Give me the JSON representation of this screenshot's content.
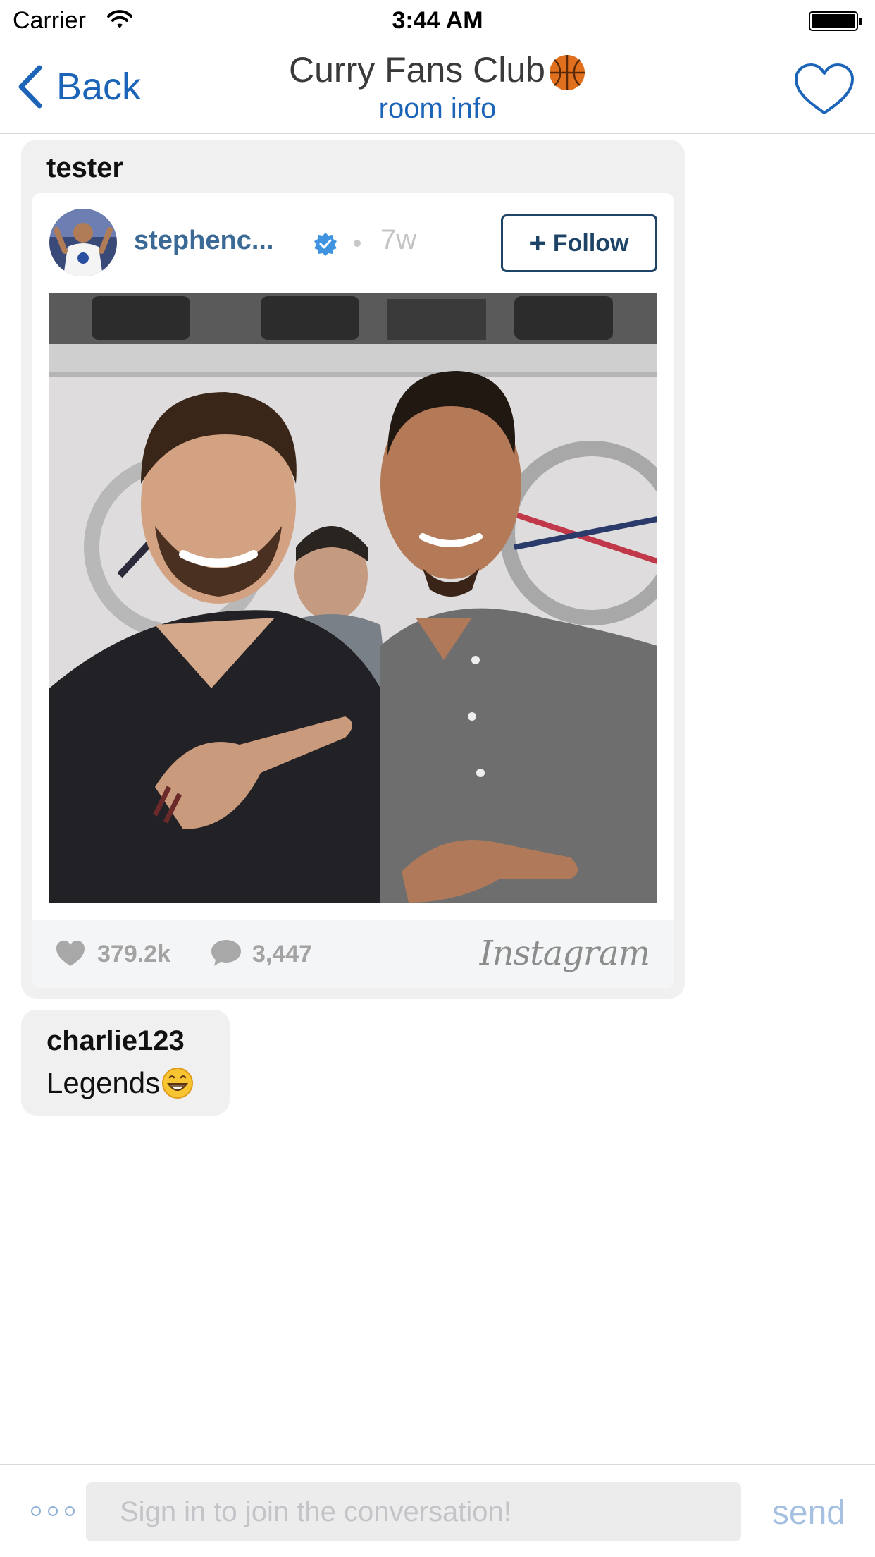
{
  "status_bar": {
    "carrier": "Carrier",
    "time": "3:44 AM"
  },
  "nav": {
    "back_label": "Back",
    "title": "Curry Fans Club",
    "title_emoji": "basketball-icon",
    "subtitle": "room info",
    "favorite_icon": "heart-outline-icon"
  },
  "messages": [
    {
      "sender": "tester",
      "instagram": {
        "username": "stephenc...",
        "verified": true,
        "time_ago": "7w",
        "follow_label": "Follow",
        "likes": "379.2k",
        "comments": "3,447",
        "brand": "Instagram"
      }
    },
    {
      "sender": "charlie123",
      "text": "Legends",
      "emoji": "grinning-face-icon"
    }
  ],
  "composer": {
    "placeholder": "Sign in to join the conversation!",
    "send_label": "send"
  },
  "colors": {
    "accent": "#1c64b8",
    "follow": "#1d4466",
    "username": "#3c6a96",
    "bubble": "#f0f0f1",
    "send_disabled": "#a6c0e2"
  }
}
